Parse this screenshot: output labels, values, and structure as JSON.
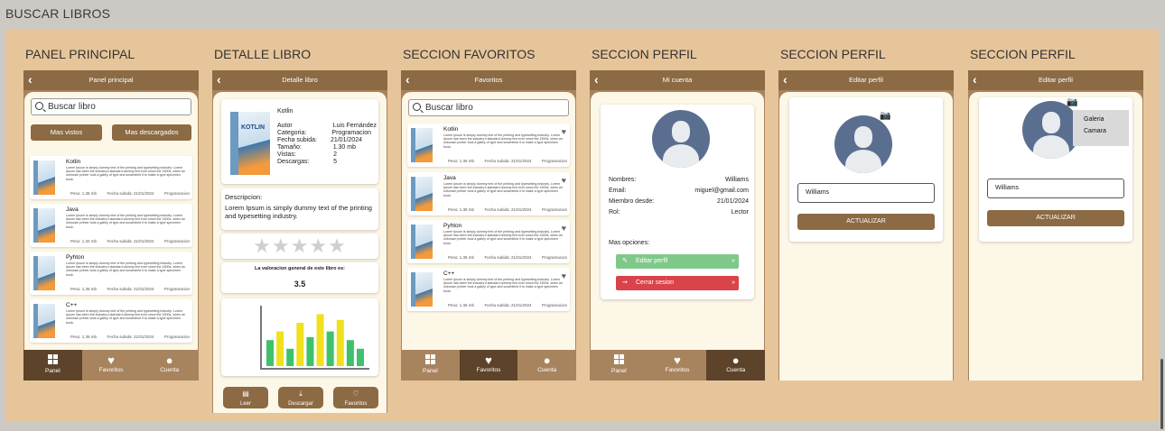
{
  "page_title": "BUSCAR LIBROS",
  "book_desc": "Lorem Ipsum is simply dummy text of the printing and typesetting industry. Lorem Ipsum has been the industry's standard dummy text ever since the 1500s, when an unknown printer took a galley of type and scrambled it to make a type specimen book.",
  "nav": {
    "panel": "Panel",
    "favoritos": "Favoritos",
    "cuenta": "Cuenta"
  },
  "panel_principal": {
    "title": "PANEL PRINCIPAL",
    "topbar": "Panel principal",
    "search_placeholder": "Buscar libro",
    "chip_vistos": "Mas vistos",
    "chip_descargados": "Mas descargados",
    "books": [
      {
        "title": "Kotlin",
        "peso": "Peso: 1.36 mb",
        "fecha": "Fecha subida: 21/01/2024",
        "cat": "Programacion"
      },
      {
        "title": "Java",
        "peso": "Peso: 1.32 mb",
        "fecha": "Fecha subida: 21/01/2024",
        "cat": "Programacion"
      },
      {
        "title": "Pyhton",
        "peso": "Peso: 1.36 mb",
        "fecha": "Fecha subida: 21/01/2024",
        "cat": "Programacion"
      },
      {
        "title": "C++",
        "peso": "Peso: 1.36 mb",
        "fecha": "Fecha subida: 21/01/2024",
        "cat": "Programacion"
      }
    ]
  },
  "detalle": {
    "title": "DETALLE LIBRO",
    "topbar": "Detalle libro",
    "book_title": "Kotlin",
    "cover_text": "KOTLIN",
    "fields": [
      {
        "k": "Autor",
        "v": "Luis Fernández"
      },
      {
        "k": "Categoria:",
        "v": "Programacion"
      },
      {
        "k": "Fecha subida:",
        "v": "21/01/2024"
      },
      {
        "k": "Tamaño:",
        "v": "1.30 mb"
      },
      {
        "k": "Vistas:",
        "v": "2"
      },
      {
        "k": "Descargas:",
        "v": "5"
      }
    ],
    "desc_label": "Descripcion:",
    "desc_text": "Lorem Ipsum is simply dummy text of the printing and typesetting industry.",
    "rating_label": "La valoracion general de este libro es:",
    "rating_value": "3.5",
    "btn_leer": "Leer",
    "btn_descargar": "Descargar",
    "btn_favoritos": "Favoritos",
    "chart_data": {
      "type": "bar",
      "categories": [
        "1",
        "2",
        "3",
        "4",
        "5",
        "6",
        "7",
        "8",
        "9",
        "10"
      ],
      "values": [
        45,
        60,
        30,
        75,
        50,
        90,
        60,
        80,
        45,
        30
      ],
      "colors": [
        "#3ec16b",
        "#f0e01e",
        "#3ec16b",
        "#f0e01e",
        "#3ec16b",
        "#f0e01e",
        "#3ec16b",
        "#f0e01e",
        "#3ec16b",
        "#3ec16b"
      ]
    }
  },
  "favoritos": {
    "title": "SECCION FAVORITOS",
    "topbar": "Favoritos",
    "search_placeholder": "Buscar libro",
    "books": [
      {
        "title": "Kotlin",
        "peso": "Peso: 1.36 mb",
        "fecha": "Fecha subida: 21/01/2024",
        "cat": "Programacion"
      },
      {
        "title": "Java",
        "peso": "Peso: 1.38 mb",
        "fecha": "Fecha subida: 21/01/2024",
        "cat": "Programacion"
      },
      {
        "title": "Pyhton",
        "peso": "Peso: 1.38 mb",
        "fecha": "Fecha subida: 21/01/2024",
        "cat": "Programacion"
      },
      {
        "title": "C++",
        "peso": "Peso: 1.36 mb",
        "fecha": "Fecha subida: 21/01/2024",
        "cat": "Programacion"
      }
    ]
  },
  "perfil": {
    "title": "SECCION PERFIL",
    "topbar": "Mi cuenta",
    "rows": [
      {
        "k": "Nombres:",
        "v": "Williams"
      },
      {
        "k": "Email:",
        "v": "miguel@gmail.com"
      },
      {
        "k": "Miembro desde:",
        "v": "21/01/2024"
      },
      {
        "k": "Rol:",
        "v": "Lector"
      }
    ],
    "mas_opciones": "Mas opciones:",
    "editar": "Editar perfil",
    "cerrar": "Cerrar sesion"
  },
  "editar1": {
    "title": "SECCION PERFIL",
    "topbar": "Editar perfil",
    "name_value": "Williams",
    "btn": "ACTUALIZAR"
  },
  "editar2": {
    "title": "SECCION PERFIL",
    "topbar": "Editar perfil",
    "name_value": "Williams",
    "btn": "ACTUALIZAR",
    "menu": [
      "Galeria",
      "Camara"
    ]
  }
}
